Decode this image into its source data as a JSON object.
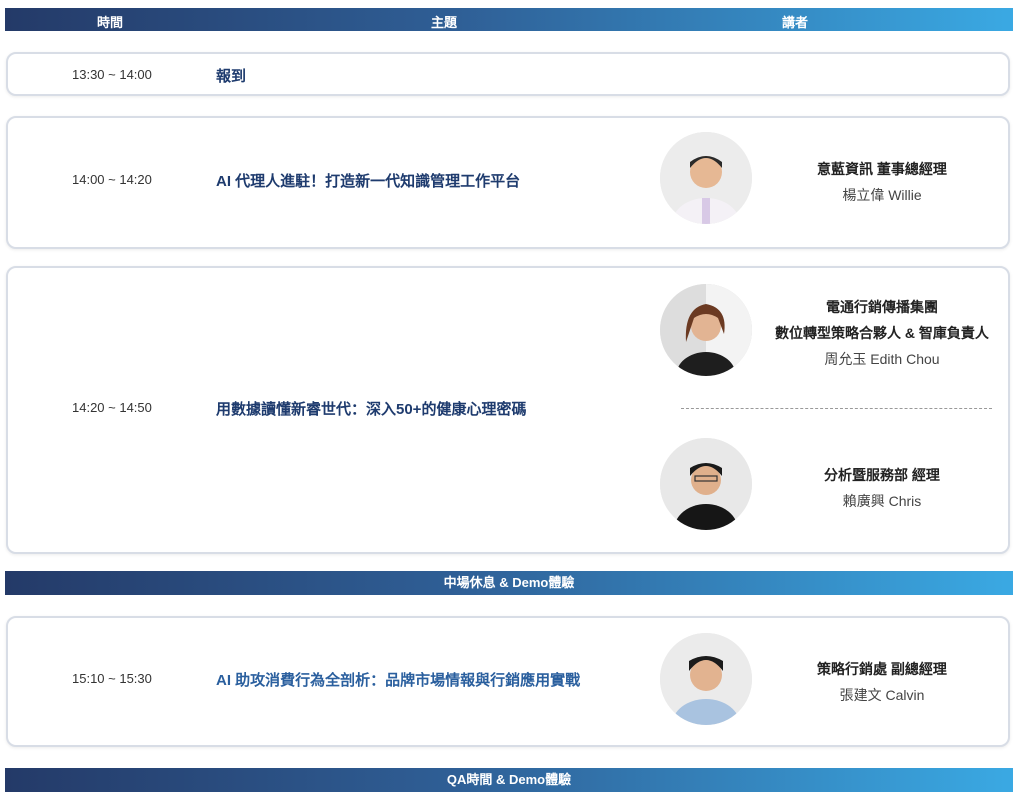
{
  "header": {
    "time": "時間",
    "topic": "主題",
    "speaker": "講者"
  },
  "sessions": [
    {
      "time": "13:30 ~ 14:00",
      "topic": "報到"
    },
    {
      "time": "14:00 ~ 14:20",
      "topic": "AI 代理人進駐！打造新一代知識管理工作平台",
      "speakers": [
        {
          "title": "意藍資訊 董事總經理",
          "name": "楊立偉 Willie"
        }
      ]
    },
    {
      "time": "14:20 ~ 14:50",
      "topic": "用數據讀懂新睿世代：深入50+的健康心理密碼",
      "speakers": [
        {
          "title1": "電通行銷傳播集團",
          "title2": "數位轉型策略合夥人 & 智庫負責人",
          "name": "周允玉 Edith Chou"
        },
        {
          "title": "分析暨服務部 經理",
          "name": "賴廣興 Chris"
        }
      ]
    },
    {
      "time": "15:10 ~ 15:30",
      "topic": "AI 助攻消費行為全剖析：品牌市場情報與行銷應用實戰",
      "speakers": [
        {
          "title": "策略行銷處 副總經理",
          "name": "張建文 Calvin"
        }
      ]
    }
  ],
  "bands": {
    "break": "中場休息 & Demo體驗",
    "qa": "QA時間 & Demo體驗"
  },
  "colors": {
    "gradient_start": "#243a68",
    "gradient_end": "#3aa9e3",
    "topic_text": "#1e3b6e"
  }
}
